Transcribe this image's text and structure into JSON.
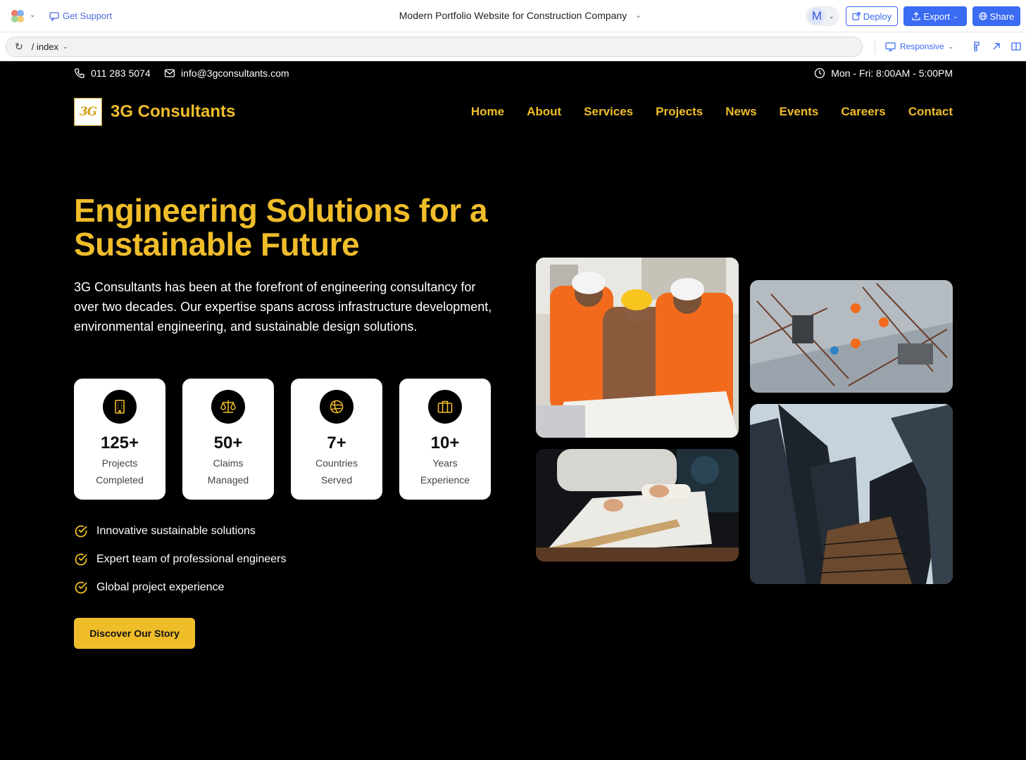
{
  "editor": {
    "support_label": "Get Support",
    "doc_title": "Modern Portfolio Website for Construction Company",
    "avatar_initial": "M",
    "deploy_label": "Deploy",
    "export_label": "Export",
    "share_label": "Share",
    "url_path": "/ index",
    "view_mode": "Responsive",
    "accent_color": "#3a6bf2"
  },
  "site": {
    "accent_color": "#f0bd2a",
    "contact": {
      "phone": "011 283 5074",
      "email": "info@3gconsultants.com",
      "hours": "Mon - Fri: 8:00AM - 5:00PM"
    },
    "brand": {
      "logo_text": "3G",
      "name": "3G Consultants"
    },
    "nav": [
      "Home",
      "About",
      "Services",
      "Projects",
      "News",
      "Events",
      "Careers",
      "Contact"
    ],
    "hero": {
      "title": "Engineering Solutions for a Sustainable Future",
      "description": "3G Consultants has been at the forefront of engineering consultancy for over two decades. Our expertise spans across infrastructure development, environmental engineering, and sustainable design solutions.",
      "stats": [
        {
          "icon": "building-icon",
          "value": "125+",
          "label": "Projects Completed"
        },
        {
          "icon": "scale-icon",
          "value": "50+",
          "label": "Claims Managed"
        },
        {
          "icon": "globe-icon",
          "value": "7+",
          "label": "Countries Served"
        },
        {
          "icon": "briefcase-icon",
          "value": "10+",
          "label": "Years Experience"
        }
      ],
      "features": [
        "Innovative sustainable solutions",
        "Expert team of professional engineers",
        "Global project experience"
      ],
      "cta_label": "Discover Our Story"
    },
    "images": [
      {
        "name": "engineers-reviewing-plans-photo"
      },
      {
        "name": "construction-site-aerial-photo"
      },
      {
        "name": "architect-drafting-blueprint-photo"
      },
      {
        "name": "skyscrapers-lookup-photo"
      }
    ]
  }
}
